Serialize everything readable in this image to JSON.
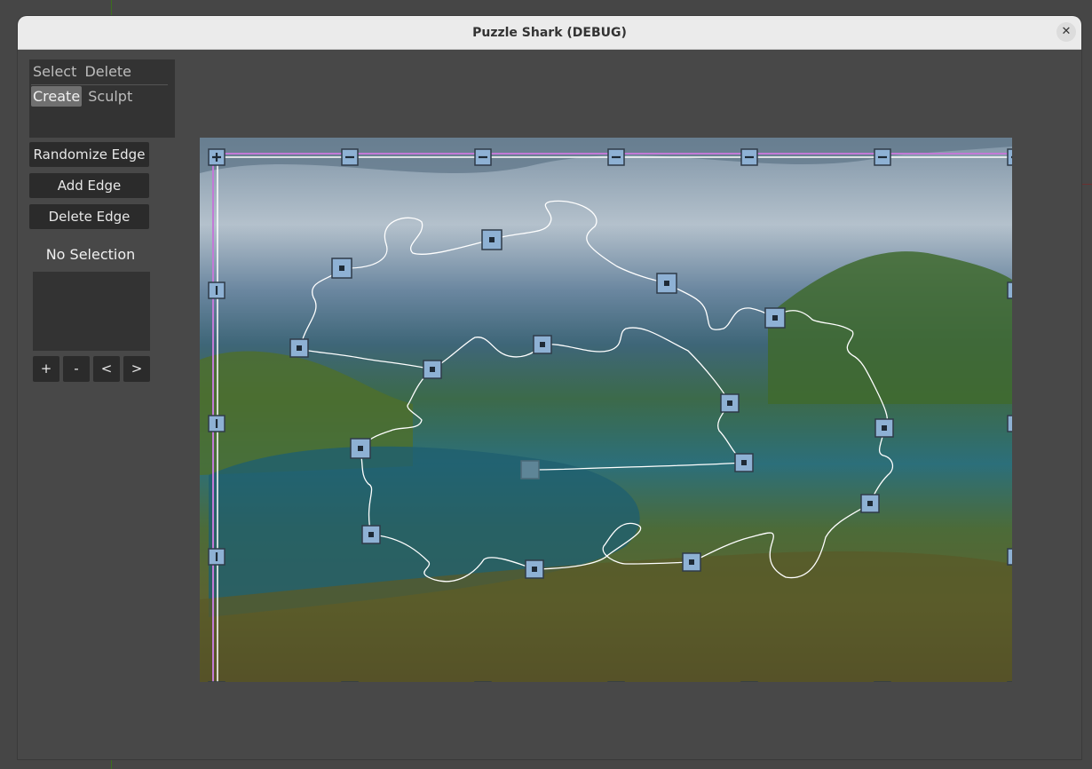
{
  "window": {
    "title": "Puzzle Shark (DEBUG)",
    "close_glyph": "✕"
  },
  "tool_panel": {
    "row1": [
      "Select",
      "Delete"
    ],
    "row2": [
      "Create",
      "Sculpt"
    ],
    "active_tool": "Create"
  },
  "actions": {
    "randomize_edge": "Randomize Edge",
    "add_edge": "Add Edge",
    "delete_edge": "Delete Edge"
  },
  "selection": {
    "label": "No Selection"
  },
  "nav": {
    "plus": "+",
    "minus": "-",
    "prev": "<",
    "next": ">"
  },
  "canvas": {
    "image_subject": "island bay landscape with green hills and turquoise water",
    "frame_color": "#c27ad6",
    "handle_color": "#8eb1d4",
    "curve_color": "#ffffff"
  }
}
